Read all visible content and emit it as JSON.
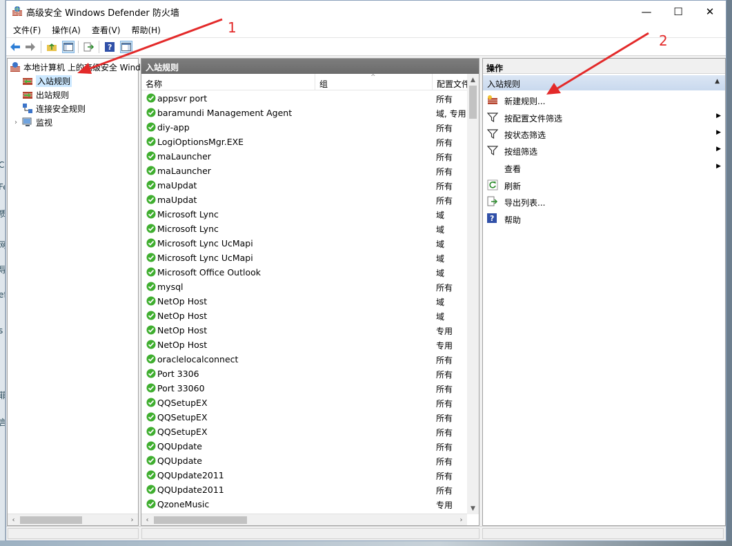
{
  "window": {
    "title": "高级安全 Windows Defender 防火墙",
    "controls": {
      "minimize": "—",
      "maximize": "☐",
      "close": "✕"
    }
  },
  "menubar": [
    "文件(F)",
    "操作(A)",
    "查看(V)",
    "帮助(H)"
  ],
  "desktop_left_glyphs": [
    "C",
    "Fe",
    "质",
    "网",
    "导",
    "ef",
    "s",
    "菲",
    "言"
  ],
  "tree": {
    "root": "本地计算机 上的高级安全 Windows Defender 防火墙",
    "items": [
      {
        "label": "入站规则",
        "icon": "inbound-rules-icon",
        "selected": true
      },
      {
        "label": "出站规则",
        "icon": "outbound-rules-icon",
        "selected": false
      },
      {
        "label": "连接安全规则",
        "icon": "connection-security-icon",
        "selected": false
      },
      {
        "label": "监视",
        "icon": "monitor-icon",
        "selected": false
      }
    ]
  },
  "center": {
    "header": "入站规则",
    "columns": [
      "名称",
      "组",
      "配置文件"
    ],
    "rows": [
      {
        "name": "appsvr port",
        "profile": "所有"
      },
      {
        "name": "baramundi Management Agent",
        "profile": "域, 专用"
      },
      {
        "name": "diy-app",
        "profile": "所有"
      },
      {
        "name": "LogiOptionsMgr.EXE",
        "profile": "所有"
      },
      {
        "name": "maLauncher",
        "profile": "所有"
      },
      {
        "name": "maLauncher",
        "profile": "所有"
      },
      {
        "name": "maUpdat",
        "profile": "所有"
      },
      {
        "name": "maUpdat",
        "profile": "所有"
      },
      {
        "name": "Microsoft Lync",
        "profile": "域"
      },
      {
        "name": "Microsoft Lync",
        "profile": "域"
      },
      {
        "name": "Microsoft Lync UcMapi",
        "profile": "域"
      },
      {
        "name": "Microsoft Lync UcMapi",
        "profile": "域"
      },
      {
        "name": "Microsoft Office Outlook",
        "profile": "域"
      },
      {
        "name": "mysql",
        "profile": "所有"
      },
      {
        "name": "NetOp Host",
        "profile": "域"
      },
      {
        "name": "NetOp Host",
        "profile": "域"
      },
      {
        "name": "NetOp Host",
        "profile": "专用"
      },
      {
        "name": "NetOp Host",
        "profile": "专用"
      },
      {
        "name": "oraclelocalconnect",
        "profile": "所有"
      },
      {
        "name": "Port 3306",
        "profile": "所有"
      },
      {
        "name": "Port 33060",
        "profile": "所有"
      },
      {
        "name": "QQSetupEX",
        "profile": "所有"
      },
      {
        "name": "QQSetupEX",
        "profile": "所有"
      },
      {
        "name": "QQSetupEX",
        "profile": "所有"
      },
      {
        "name": "QQUpdate",
        "profile": "所有"
      },
      {
        "name": "QQUpdate",
        "profile": "所有"
      },
      {
        "name": "QQUpdate2011",
        "profile": "所有"
      },
      {
        "name": "QQUpdate2011",
        "profile": "所有"
      },
      {
        "name": "QzoneMusic",
        "profile": "专用"
      }
    ]
  },
  "actions": {
    "header": "操作",
    "section": "入站规则",
    "items": [
      {
        "label": "新建规则...",
        "icon": "new-rule-icon",
        "submenu": false
      },
      {
        "label": "按配置文件筛选",
        "icon": "filter-icon",
        "submenu": true
      },
      {
        "label": "按状态筛选",
        "icon": "filter-icon",
        "submenu": true
      },
      {
        "label": "按组筛选",
        "icon": "filter-icon",
        "submenu": true
      },
      {
        "label": "查看",
        "icon": "",
        "submenu": true
      },
      {
        "label": "刷新",
        "icon": "refresh-icon",
        "submenu": false
      },
      {
        "label": "导出列表...",
        "icon": "export-icon",
        "submenu": false
      },
      {
        "label": "帮助",
        "icon": "help-icon",
        "submenu": false
      }
    ]
  },
  "annotations": {
    "arrow1_label": "1",
    "arrow2_label": "2",
    "color": "#e32a2a"
  }
}
